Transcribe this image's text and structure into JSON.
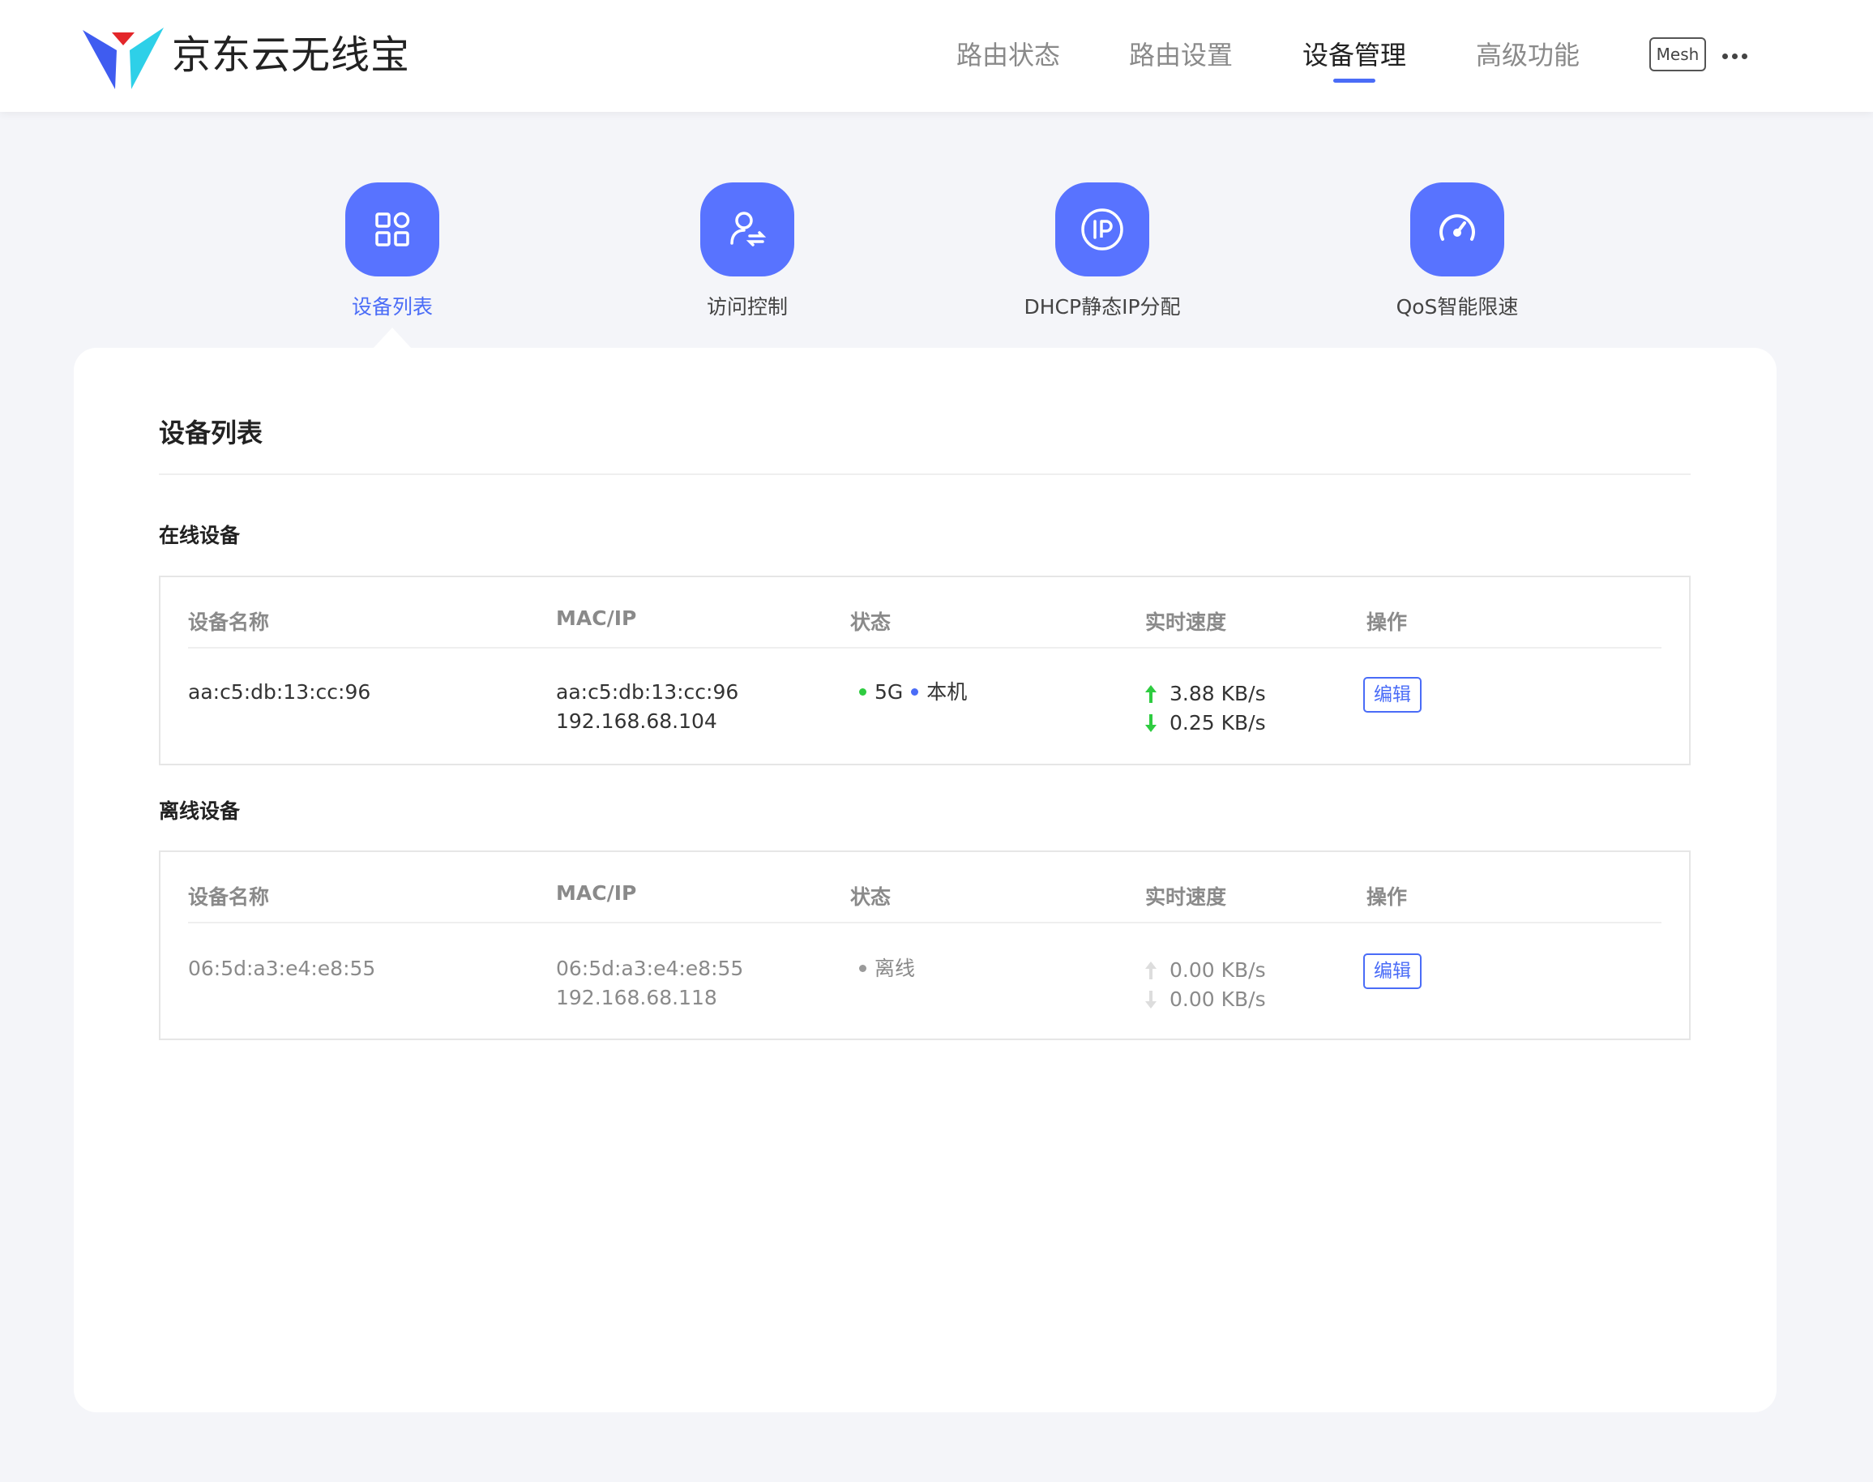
{
  "header": {
    "brand": "京东云无线宝",
    "nav": [
      {
        "label": "路由状态"
      },
      {
        "label": "路由设置"
      },
      {
        "label": "设备管理"
      },
      {
        "label": "高级功能"
      }
    ],
    "active_nav": "设备管理",
    "mesh_label": "Mesh",
    "more_icon": "more-horizontal-icon"
  },
  "functions": [
    {
      "label": "设备列表",
      "icon": "grid-icon"
    },
    {
      "label": "访问控制",
      "icon": "user-switch-icon"
    },
    {
      "label": "DHCP静态IP分配",
      "icon": "ip-icon"
    },
    {
      "label": "QoS智能限速",
      "icon": "speedometer-icon"
    }
  ],
  "card": {
    "title": "设备列表",
    "columns": [
      "设备名称",
      "MAC/IP",
      "状态",
      "实时速度",
      "操作"
    ],
    "online": {
      "title": "在线设备",
      "rows": [
        {
          "name": "aa:c5:db:13:cc:96",
          "mac": "aa:c5:db:13:cc:96",
          "ip": "192.168.68.104",
          "band": "5G",
          "tag": "本机",
          "up": "3.88 KB/s",
          "down": "0.25 KB/s",
          "action": "编辑"
        }
      ]
    },
    "offline": {
      "title": "离线设备",
      "rows": [
        {
          "name": "06:5d:a3:e4:e8:55",
          "mac": "06:5d:a3:e4:e8:55",
          "ip": "192.168.68.118",
          "status": "离线",
          "up": "0.00 KB/s",
          "down": "0.00 KB/s",
          "action": "编辑"
        }
      ]
    }
  },
  "colors": {
    "accent": "#5873ff",
    "link": "#4a6cf7",
    "online": "#2ecc40",
    "up_arrow": "#2ecc40",
    "down_arrow": "#2ecc40",
    "offline_gray": "#9a9a9a"
  }
}
